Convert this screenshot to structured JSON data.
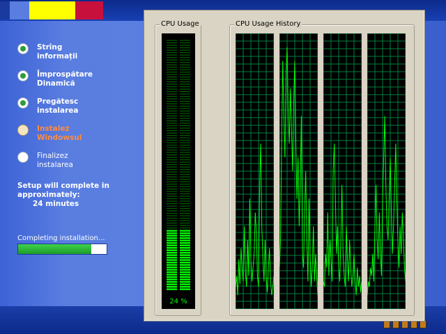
{
  "installer": {
    "steps": [
      {
        "line1": "Strîng",
        "line2": "informații",
        "state": "done"
      },
      {
        "line1": "Împrospătare",
        "line2": "Dinamică",
        "state": "done"
      },
      {
        "line1": "Pregătesc",
        "line2": "instalarea",
        "state": "done"
      },
      {
        "line1": "Instalez",
        "line2": "Windowsul",
        "state": "current"
      },
      {
        "line1": "Finalizez",
        "line2": "instalarea",
        "state": "pending"
      }
    ],
    "complete_line1": "Setup will complete in",
    "complete_line2": "approximately:",
    "complete_time": "24 minutes",
    "progress_label": "Completing installation...",
    "progress_fraction": 0.83
  },
  "task_manager": {
    "cpu_usage_title": "CPU Usage",
    "cpu_history_title": "CPU Usage History",
    "cpu_percent_value": 24,
    "cpu_percent_label": "24 %",
    "history_cores": [
      [
        8,
        12,
        5,
        18,
        9,
        22,
        15,
        10,
        30,
        14,
        8,
        25,
        12,
        40,
        18,
        10,
        15,
        20,
        35,
        28,
        12,
        8,
        45,
        60,
        30,
        18,
        10,
        25,
        12,
        6,
        15,
        22,
        10,
        5,
        8,
        12
      ],
      [
        15,
        25,
        60,
        90,
        70,
        55,
        85,
        95,
        70,
        60,
        80,
        65,
        50,
        75,
        90,
        60,
        40,
        55,
        30,
        45,
        70,
        20,
        15,
        35,
        50,
        25,
        10,
        40,
        20,
        8,
        15,
        30,
        10,
        20,
        12,
        5
      ],
      [
        10,
        8,
        20,
        15,
        35,
        12,
        25,
        18,
        10,
        50,
        60,
        40,
        20,
        30,
        15,
        10,
        25,
        45,
        20,
        12,
        8,
        30,
        18,
        10,
        25,
        15,
        8,
        12,
        20,
        10,
        5,
        15,
        8,
        12,
        6,
        10
      ],
      [
        5,
        10,
        8,
        15,
        12,
        20,
        10,
        30,
        45,
        25,
        18,
        35,
        20,
        12,
        40,
        55,
        70,
        45,
        30,
        25,
        40,
        55,
        35,
        20,
        30,
        45,
        60,
        40,
        25,
        15,
        30,
        20,
        35,
        25,
        15,
        10
      ]
    ],
    "colors": {
      "graph_line": "#00ff00",
      "grid": "#008040",
      "meter_on": "#00ff00",
      "meter_off": "#006000"
    }
  }
}
